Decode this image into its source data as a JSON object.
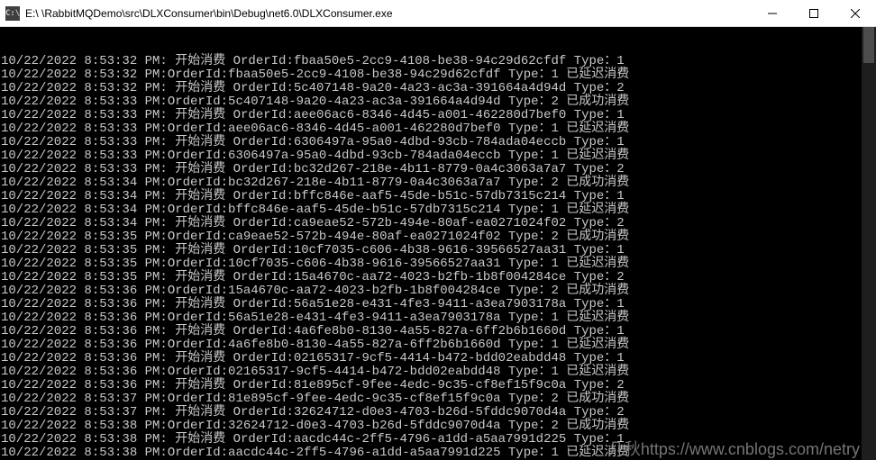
{
  "window": {
    "title": "E:\\   \\RabbitMQDemo\\src\\DLXConsumer\\bin\\Debug\\net6.0\\DLXConsumer.exe",
    "icon_label": "C:\\"
  },
  "watermark": "几秋https://www.cnblogs.com/netry",
  "lines": [
    "10/22/2022 8:53:32 PM: 开始消费 OrderId:fbaa50e5-2cc9-4108-be38-94c29d62cfdf Type：1",
    "10/22/2022 8:53:32 PM:OrderId:fbaa50e5-2cc9-4108-be38-94c29d62cfdf Type：1 已延迟消费",
    "10/22/2022 8:53:32 PM: 开始消费 OrderId:5c407148-9a20-4a23-ac3a-391664a4d94d Type：2",
    "10/22/2022 8:53:33 PM:OrderId:5c407148-9a20-4a23-ac3a-391664a4d94d Type：2 已成功消费",
    "10/22/2022 8:53:33 PM: 开始消费 OrderId:aee06ac6-8346-4d45-a001-462280d7bef0 Type：1",
    "10/22/2022 8:53:33 PM:OrderId:aee06ac6-8346-4d45-a001-462280d7bef0 Type：1 已延迟消费",
    "10/22/2022 8:53:33 PM: 开始消费 OrderId:6306497a-95a0-4dbd-93cb-784ada04eccb Type：1",
    "10/22/2022 8:53:33 PM:OrderId:6306497a-95a0-4dbd-93cb-784ada04eccb Type：1 已延迟消费",
    "10/22/2022 8:53:33 PM: 开始消费 OrderId:bc32d267-218e-4b11-8779-0a4c3063a7a7 Type：2",
    "10/22/2022 8:53:34 PM:OrderId:bc32d267-218e-4b11-8779-0a4c3063a7a7 Type：2 已成功消费",
    "10/22/2022 8:53:34 PM: 开始消费 OrderId:bffc846e-aaf5-45de-b51c-57db7315c214 Type：1",
    "10/22/2022 8:53:34 PM:OrderId:bffc846e-aaf5-45de-b51c-57db7315c214 Type：1 已延迟消费",
    "10/22/2022 8:53:34 PM: 开始消费 OrderId:ca9eae52-572b-494e-80af-ea0271024f02 Type：2",
    "10/22/2022 8:53:35 PM:OrderId:ca9eae52-572b-494e-80af-ea0271024f02 Type：2 已成功消费",
    "10/22/2022 8:53:35 PM: 开始消费 OrderId:10cf7035-c606-4b38-9616-39566527aa31 Type：1",
    "10/22/2022 8:53:35 PM:OrderId:10cf7035-c606-4b38-9616-39566527aa31 Type：1 已延迟消费",
    "10/22/2022 8:53:35 PM: 开始消费 OrderId:15a4670c-aa72-4023-b2fb-1b8f004284ce Type：2",
    "10/22/2022 8:53:36 PM:OrderId:15a4670c-aa72-4023-b2fb-1b8f004284ce Type：2 已成功消费",
    "10/22/2022 8:53:36 PM: 开始消费 OrderId:56a51e28-e431-4fe3-9411-a3ea7903178a Type：1",
    "10/22/2022 8:53:36 PM:OrderId:56a51e28-e431-4fe3-9411-a3ea7903178a Type：1 已延迟消费",
    "10/22/2022 8:53:36 PM: 开始消费 OrderId:4a6fe8b0-8130-4a55-827a-6ff2b6b1660d Type：1",
    "10/22/2022 8:53:36 PM:OrderId:4a6fe8b0-8130-4a55-827a-6ff2b6b1660d Type：1 已延迟消费",
    "10/22/2022 8:53:36 PM: 开始消费 OrderId:02165317-9cf5-4414-b472-bdd02eabdd48 Type：1",
    "10/22/2022 8:53:36 PM:OrderId:02165317-9cf5-4414-b472-bdd02eabdd48 Type：1 已延迟消费",
    "10/22/2022 8:53:36 PM: 开始消费 OrderId:81e895cf-9fee-4edc-9c35-cf8ef15f9c0a Type：2",
    "10/22/2022 8:53:37 PM:OrderId:81e895cf-9fee-4edc-9c35-cf8ef15f9c0a Type：2 已成功消费",
    "10/22/2022 8:53:37 PM: 开始消费 OrderId:32624712-d0e3-4703-b26d-5fddc9070d4a Type：2",
    "10/22/2022 8:53:38 PM:OrderId:32624712-d0e3-4703-b26d-5fddc9070d4a Type：2 已成功消费",
    "10/22/2022 8:53:38 PM: 开始消费 OrderId:aacdc44c-2ff5-4796-a1dd-a5aa7991d225 Type：1",
    "10/22/2022 8:53:38 PM:OrderId:aacdc44c-2ff5-4796-a1dd-a5aa7991d225 Type：1 已延迟消费"
  ]
}
